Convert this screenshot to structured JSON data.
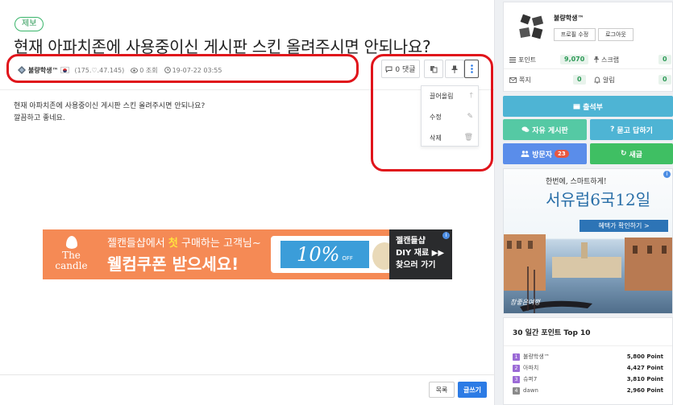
{
  "post": {
    "category": "제보",
    "title": "현재 아파치존에 사용중이신 게시판 스킨 올려주시면 안되나요?",
    "author": "불량학생™",
    "meta": {
      "level": "(175.♡.47.145)",
      "views": "0 조회",
      "date": "19-07-22 03:55"
    },
    "actions": {
      "comment_label": "0 댓글"
    },
    "dropdown": [
      "끌어올림",
      "수정",
      "삭제"
    ],
    "body": [
      "현재 아파치존에 사용중이신 게시판 스킨 올려주시면 안되나요?",
      "깔끔하고 좋네요."
    ]
  },
  "ad": {
    "line1_pre": "젤캔들샵에서 ",
    "line1_emph": "첫",
    "line1_post": " 구매하는 고객님~",
    "line2": "웰컴쿠폰 받으세요!",
    "logo": "The candle",
    "coupon": "10%",
    "coupon_off": "OFF",
    "right": [
      "젤캔들샵",
      "DIY 재료 ▶▶",
      "찾으러 가기"
    ],
    "info": "i"
  },
  "footer": {
    "list_label": "목록",
    "write_label": "글쓰기"
  },
  "profile": {
    "name": "불량학생™",
    "edit_label": "프로필 수정",
    "logout_label": "로그아웃",
    "stats": {
      "points_label": "포인트",
      "points_value": "9,070",
      "scrap_label": "스크랩",
      "scrap_value": "0",
      "note_label": "쪽지",
      "note_value": "0",
      "alarm_label": "알림",
      "alarm_value": "0"
    }
  },
  "nav": {
    "attendance": "출석부",
    "free_board": "자유 게시판",
    "qna": "묻고 답하기",
    "visitors": "방문자",
    "visitor_count": "23",
    "refresh": "새글"
  },
  "travel_ad": {
    "headline": "한번에, 스마트하게!",
    "title": "서유럽6국12일",
    "cta": "혜택가 확인하기 >",
    "sig": "참좋은여행",
    "info": "i"
  },
  "top_points": {
    "title": "30 일간 포인트 Top 10",
    "rows": [
      {
        "rank": "1",
        "name": "불량학생™",
        "points": "5,800 Point"
      },
      {
        "rank": "2",
        "name": "아파치",
        "points": "4,427 Point"
      },
      {
        "rank": "3",
        "name": "슈퍼7",
        "points": "3,810 Point"
      },
      {
        "rank": "4",
        "name": "dawn",
        "points": "2,960 Point"
      }
    ]
  },
  "colors": {
    "accent_blue": "#2c7be5",
    "annotation_red": "#e0141b",
    "rank_purple": "#9b6ad6"
  }
}
